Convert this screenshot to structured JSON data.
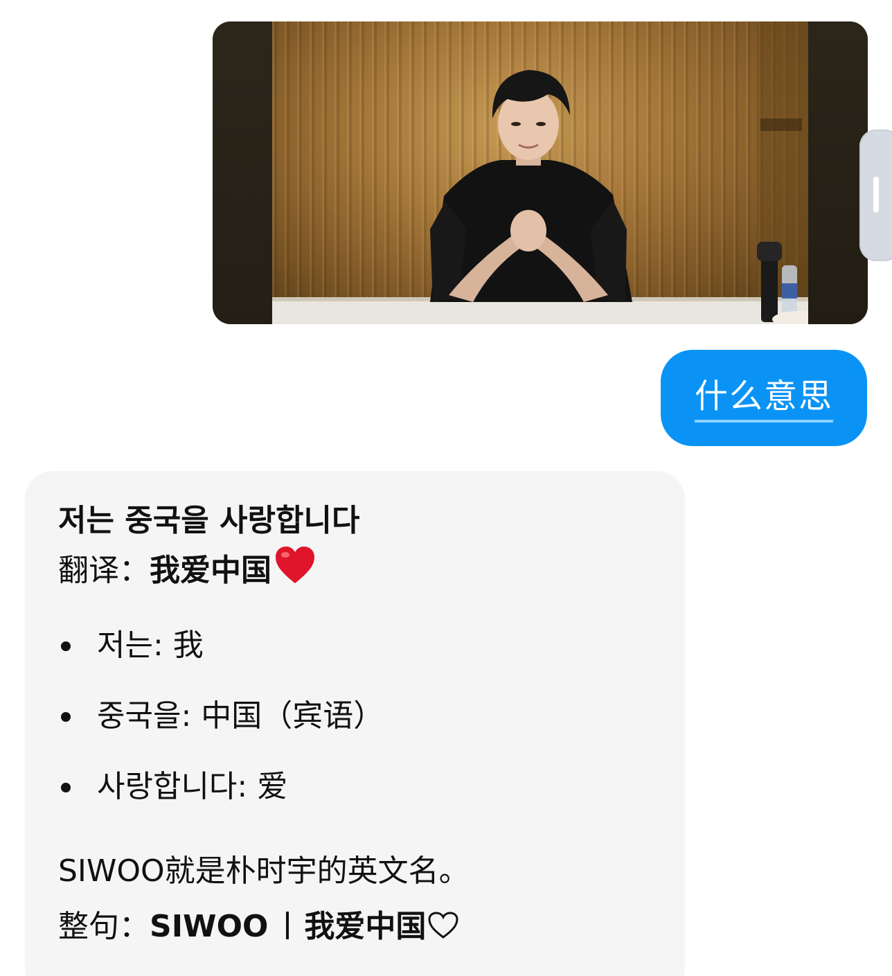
{
  "chat": {
    "image_message": {
      "kind": "photo",
      "icon": "photo-thumbnail"
    },
    "user_message": {
      "text": "什么意思"
    },
    "reply": {
      "heading": "저는 중국을 사랑합니다",
      "translation_label": "翻译：",
      "translation_value": "我爱中国",
      "translation_icon": "red-heart-icon",
      "bullets": [
        {
          "term": "저는:",
          "meaning": "我"
        },
        {
          "term": "중국을:",
          "meaning": "中国（宾语）"
        },
        {
          "term": "사랑합니다:",
          "meaning": "爱"
        }
      ],
      "note": "SIWOO就是朴时宇的英文名。",
      "full_label": "整句：",
      "full_name": "SIWOO",
      "full_phrase": "我爱中国",
      "full_icon": "outline-heart-icon"
    }
  },
  "colors": {
    "user_bubble": "#0a93f5",
    "reply_card": "#f5f5f5",
    "heart": "#e0142a"
  }
}
